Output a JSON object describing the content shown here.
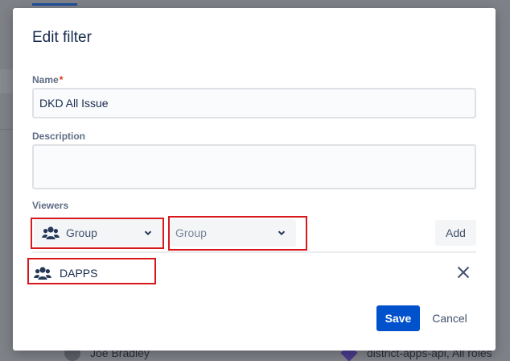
{
  "background": {
    "row_left_text": "Joe Bradley",
    "row_right_text": "district-apps-api, All roles"
  },
  "dialog": {
    "title": "Edit filter",
    "name_label": "Name",
    "required_marker": "*",
    "name_value": "DKD All Issue",
    "description_label": "Description",
    "description_value": "",
    "viewers_label": "Viewers",
    "viewer_type_selected": "Group",
    "group_select_placeholder": "Group",
    "add_label": "Add",
    "viewers": [
      {
        "type_icon": "group-icon",
        "name": "DAPPS"
      }
    ],
    "save_label": "Save",
    "cancel_label": "Cancel"
  },
  "colors": {
    "primary": "#0052cc",
    "heading": "#172b4d",
    "annotation": "#d7191c",
    "required": "#de350b"
  }
}
